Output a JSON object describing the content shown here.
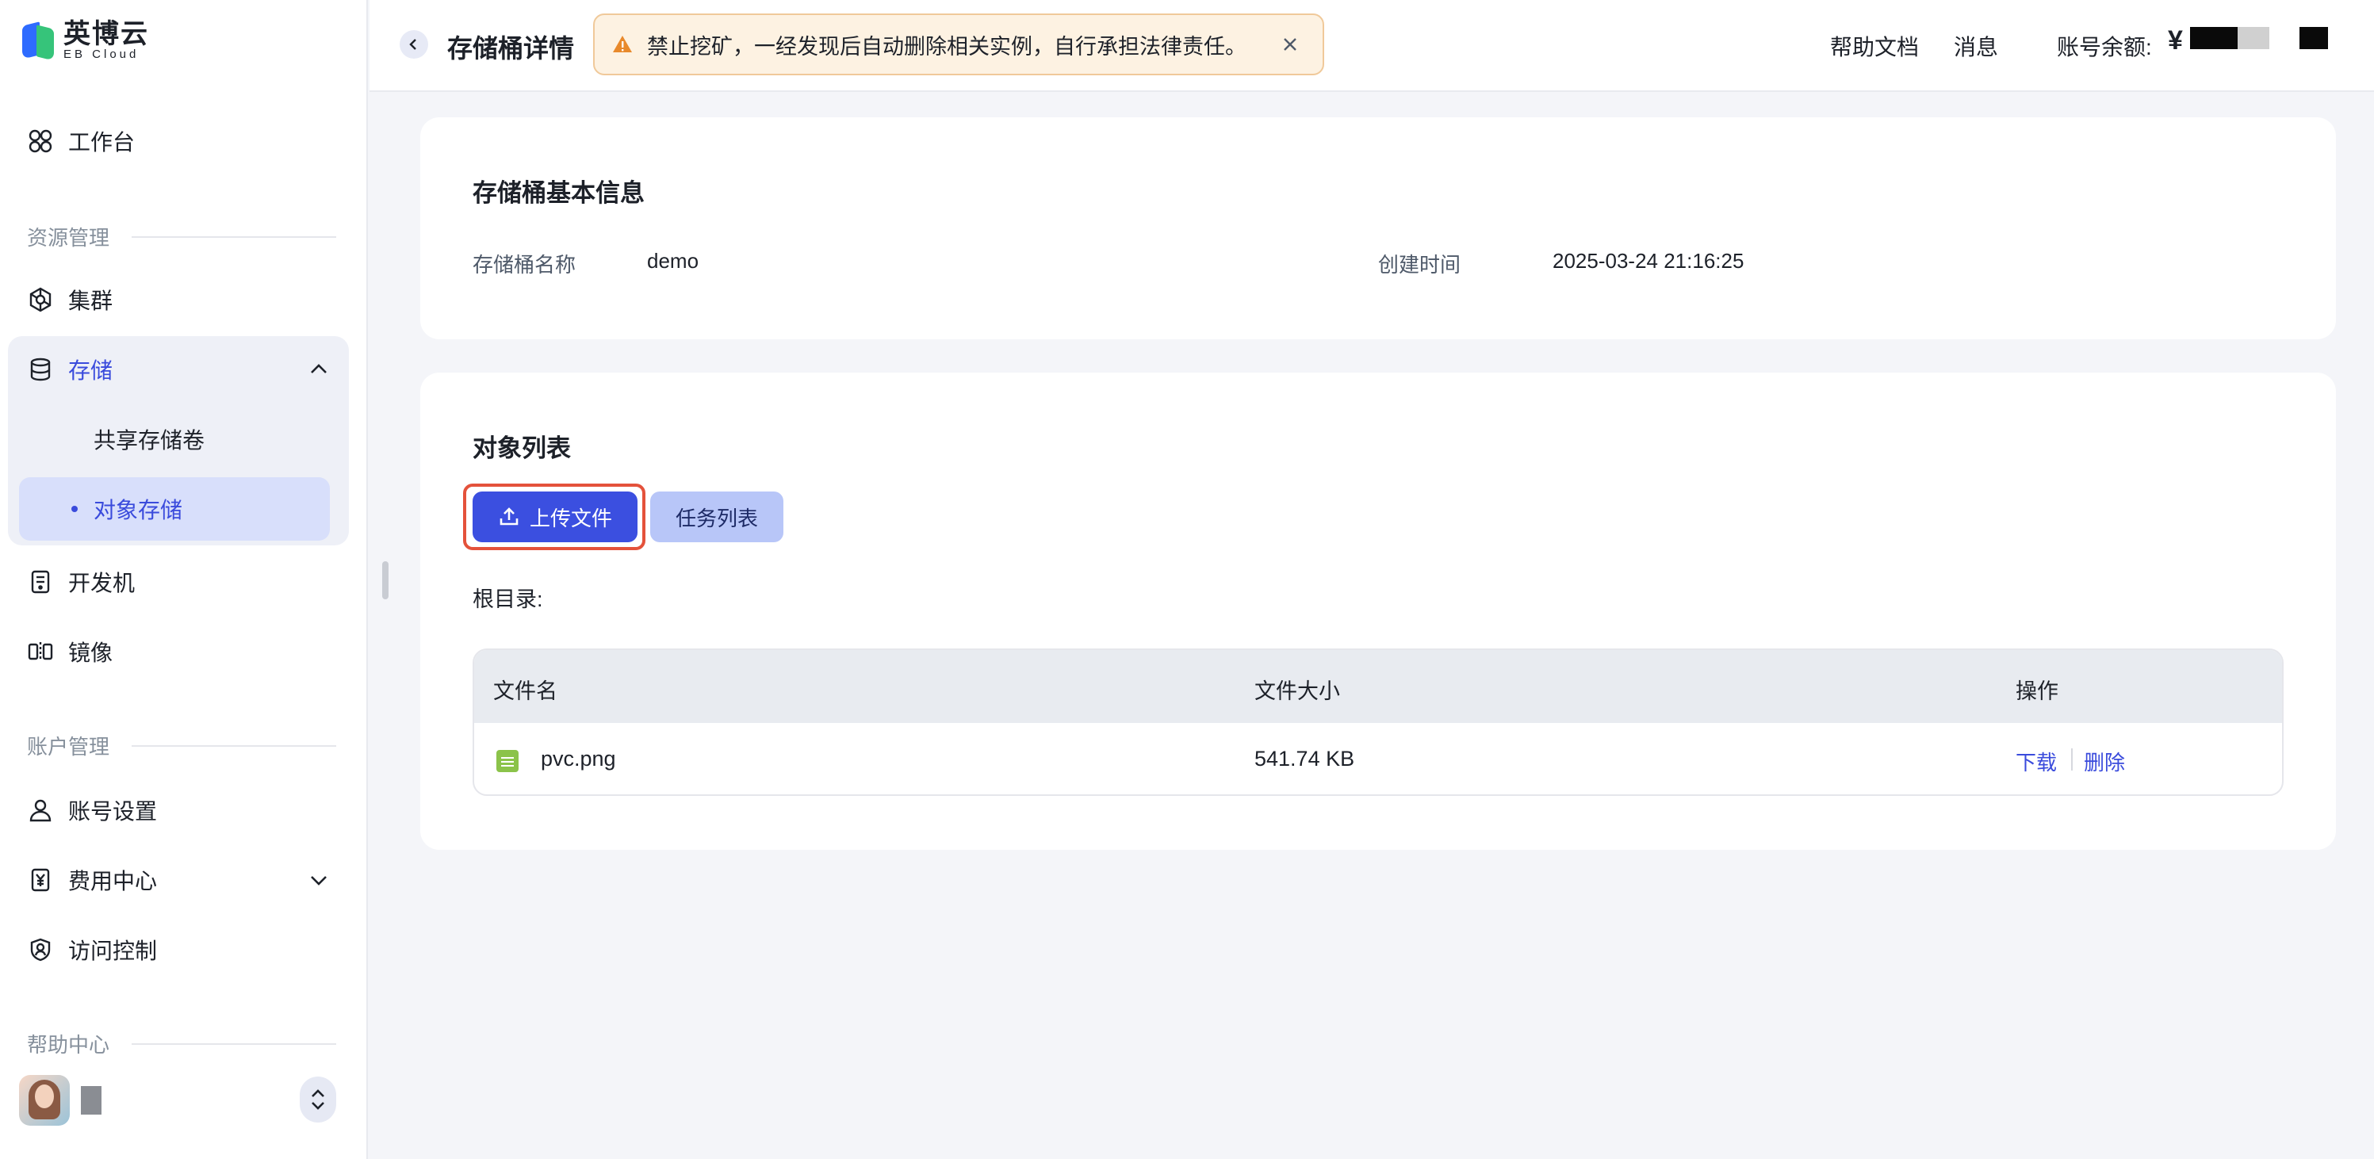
{
  "app": {
    "brand_cn": "英博云",
    "brand_en": "EB Cloud"
  },
  "sidebar": {
    "workbench": "工作台",
    "resource_section": "资源管理",
    "cluster": "集群",
    "storage": "存储",
    "shared_volume": "共享存储卷",
    "object_storage": "对象存储",
    "devbox": "开发机",
    "image": "镜像",
    "account_section": "账户管理",
    "account_settings": "账号设置",
    "billing": "费用中心",
    "access_control": "访问控制",
    "help_section": "帮助中心"
  },
  "header": {
    "title": "存储桶详情",
    "notice": "禁止挖矿，一经发现后自动删除相关实例，自行承担法律责任。",
    "help_docs": "帮助文档",
    "messages": "消息",
    "balance_label": "账号余额:",
    "currency": "¥"
  },
  "basic_info": {
    "title": "存储桶基本信息",
    "name_label": "存储桶名称",
    "name_value": "demo",
    "created_label": "创建时间",
    "created_value": "2025-03-24 21:16:25"
  },
  "objects": {
    "title": "对象列表",
    "upload_button": "上传文件",
    "tasks_button": "任务列表",
    "root_label": "根目录:",
    "columns": {
      "name": "文件名",
      "size": "文件大小",
      "actions": "操作"
    },
    "rows": [
      {
        "name": "pvc.png",
        "size": "541.74 KB",
        "download": "下载",
        "delete": "删除"
      }
    ]
  },
  "colors": {
    "primary": "#3b4fe0",
    "highlight": "#e4523b",
    "notice_bg": "#fdf2e2"
  }
}
